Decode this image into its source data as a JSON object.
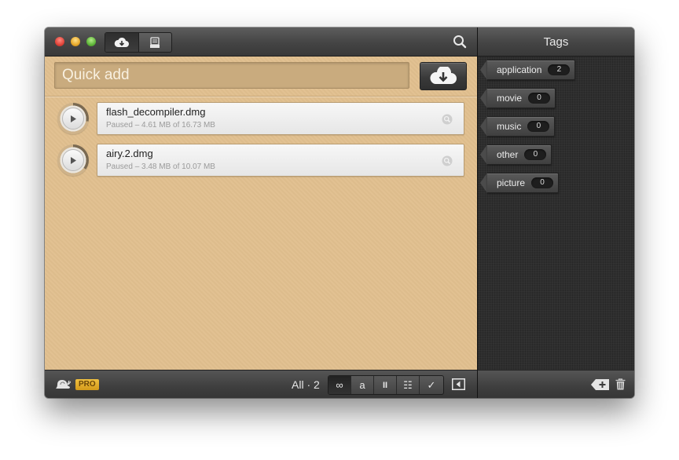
{
  "toolbar": {
    "segments": [
      "cloud-download-icon",
      "inbox-list-icon"
    ]
  },
  "quick_add": {
    "placeholder": "Quick add"
  },
  "downloads": [
    {
      "name": "flash_decompiler.dmg",
      "status": "Paused – 4.61 MB of 16.73 MB",
      "progress": 0.28
    },
    {
      "name": "airy.2.dmg",
      "status": "Paused – 3.48 MB of 10.07 MB",
      "progress": 0.35
    }
  ],
  "bottom": {
    "badge": "PRO",
    "filter_label": "All · 2",
    "filters": [
      "∞",
      "a",
      "II",
      "☷",
      "✓"
    ]
  },
  "tags_panel": {
    "title": "Tags",
    "tags": [
      {
        "label": "application",
        "count": "2"
      },
      {
        "label": "movie",
        "count": "0"
      },
      {
        "label": "music",
        "count": "0"
      },
      {
        "label": "other",
        "count": "0"
      },
      {
        "label": "picture",
        "count": "0"
      }
    ]
  },
  "colors": {
    "content_bg": "#e1c08f",
    "pro_badge": "#e0aa2a",
    "sidebar_bg": "#2e2e2e"
  }
}
